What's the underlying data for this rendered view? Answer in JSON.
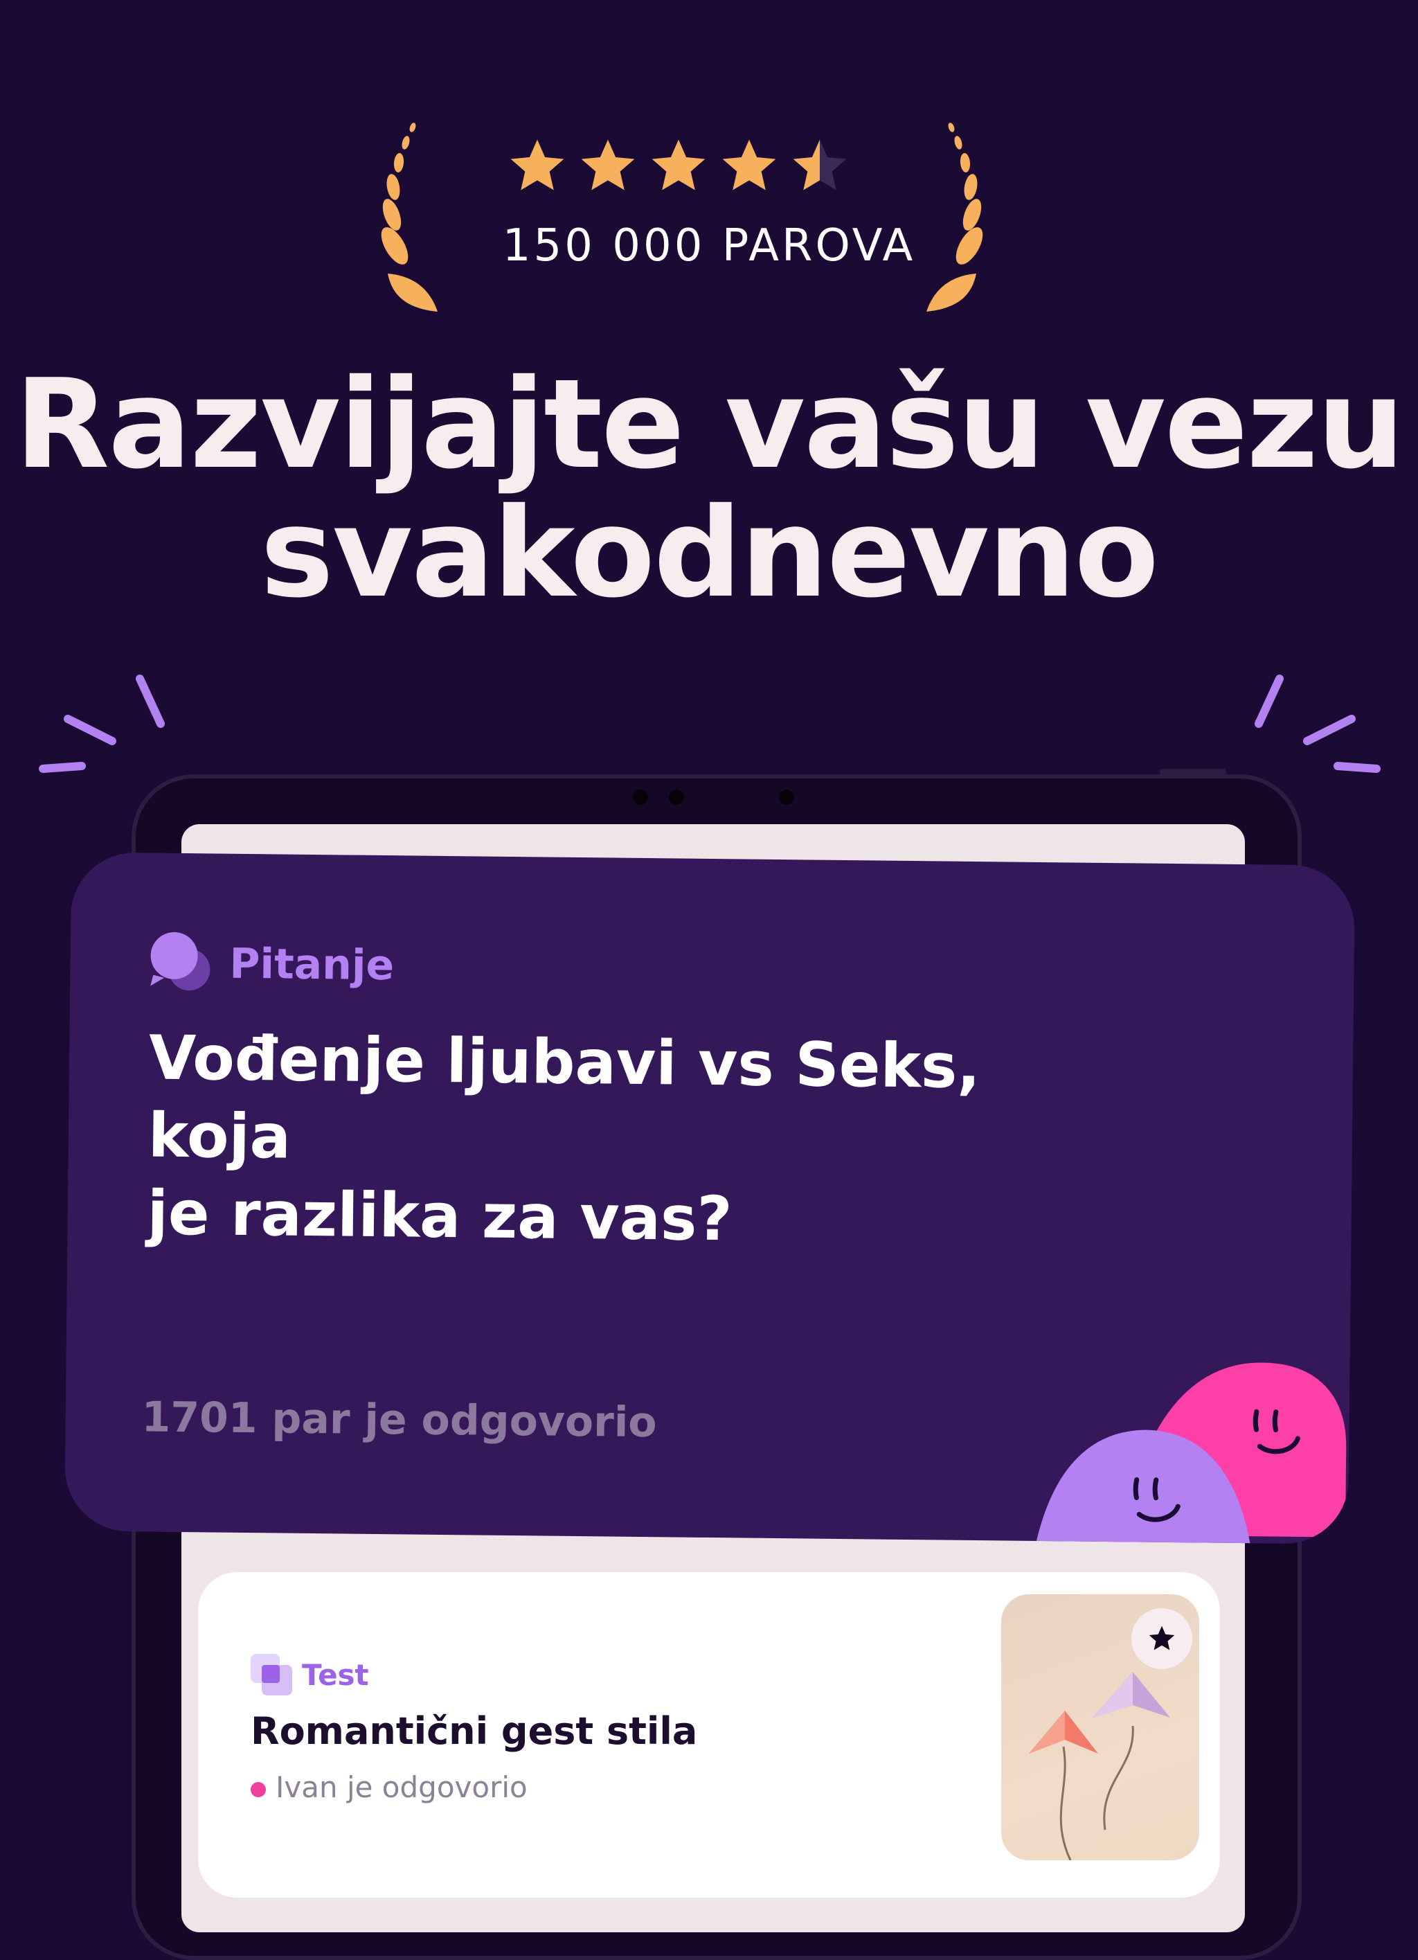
{
  "rating": {
    "stars": 4.5,
    "max_stars": 5,
    "count_label": "150 000 PAROVA"
  },
  "headline": {
    "line1": "Razvijajte vašu vezu",
    "line2": "svakodnevno"
  },
  "question_card": {
    "label": "Pitanje",
    "question_line1": "Vođenje ljubavi vs Seks, koja",
    "question_line2": "je razlika za vas?",
    "answered": "1701 par je odgovorio"
  },
  "test_card": {
    "label": "Test",
    "title": "Romantični gest stila",
    "status": "Ivan je odgovorio"
  },
  "colors": {
    "background": "#1b0a33",
    "card": "#34185a",
    "accent_purple": "#b381f2",
    "accent_pink": "#fd3fa8",
    "star": "#f7b05c"
  }
}
